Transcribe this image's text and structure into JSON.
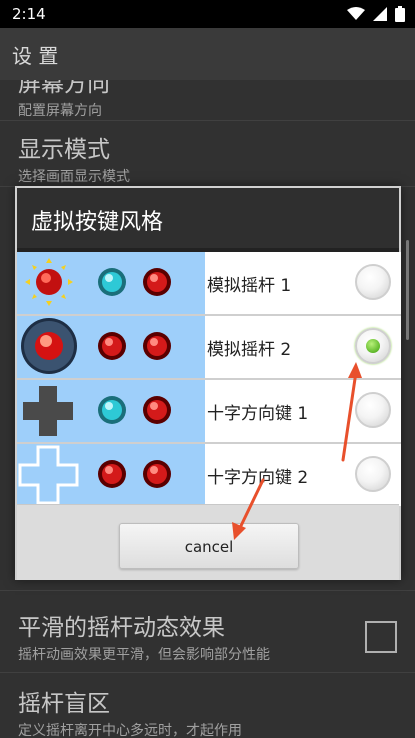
{
  "status_bar": {
    "time": "2:14"
  },
  "app_bar": {
    "title": "设 置"
  },
  "settings": {
    "screen_orientation": {
      "title": "屏幕方向",
      "subtitle": "配置屏幕方向"
    },
    "display_mode": {
      "title": "显示模式",
      "subtitle": "选择画面显示模式"
    },
    "smooth_joystick": {
      "title": "平滑的摇杆动态效果",
      "subtitle": "摇杆动画效果更平滑，但会影响部分性能",
      "checked": false
    },
    "joystick_deadzone": {
      "title": "摇杆盲区",
      "subtitle": "定义摇杆离开中心多远时，才起作用"
    }
  },
  "dialog": {
    "title": "虚拟按键风格",
    "options": [
      {
        "label": "模拟摇杆 1",
        "selected": false
      },
      {
        "label": "模拟摇杆 2",
        "selected": true
      },
      {
        "label": "十字方向键 1",
        "selected": false
      },
      {
        "label": "十字方向键 2",
        "selected": false
      }
    ],
    "cancel_label": "cancel"
  },
  "colors": {
    "accent_green": "#5fb82a",
    "thumb_bg": "#9ecffa",
    "annotation_arrow": "#e8502c"
  }
}
